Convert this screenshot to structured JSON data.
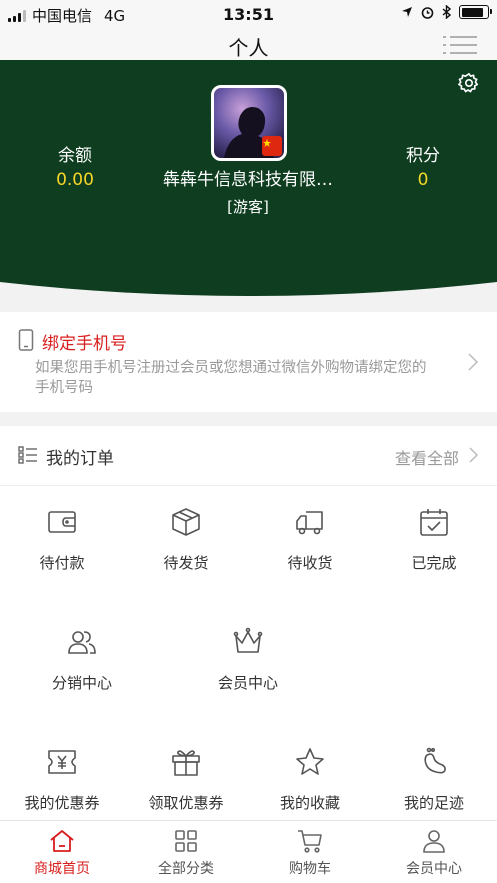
{
  "status_bar": {
    "carrier": "中国电信",
    "network": "4G",
    "time": "13:51"
  },
  "nav": {
    "title": "个人"
  },
  "profile": {
    "balance_label": "余额",
    "balance_value": "0.00",
    "points_label": "积分",
    "points_value": "0",
    "company_name": "犇犇牛信息科技有限…",
    "role": "[游客]"
  },
  "bind_phone": {
    "title": "绑定手机号",
    "description": "如果您用手机号注册过会员或您想通过微信外购物请绑定您的手机号码"
  },
  "orders": {
    "title": "我的订单",
    "view_all": "查看全部",
    "items": [
      {
        "label": "待付款",
        "icon": "wallet-icon"
      },
      {
        "label": "待发货",
        "icon": "package-icon"
      },
      {
        "label": "待收货",
        "icon": "truck-icon"
      },
      {
        "label": "已完成",
        "icon": "calendar-check-icon"
      },
      {
        "label": "分销中心",
        "icon": "users-icon"
      },
      {
        "label": "会员中心",
        "icon": "crown-icon"
      },
      {
        "label": "我的优惠券",
        "icon": "coupon-icon"
      },
      {
        "label": "领取优惠券",
        "icon": "gift-icon"
      },
      {
        "label": "我的收藏",
        "icon": "star-icon"
      },
      {
        "label": "我的足迹",
        "icon": "footprint-icon"
      }
    ]
  },
  "tabbar": {
    "items": [
      {
        "label": "商城首页",
        "icon": "home-icon",
        "active": true
      },
      {
        "label": "全部分类",
        "icon": "grid-icon",
        "active": false
      },
      {
        "label": "购物车",
        "icon": "cart-icon",
        "active": false
      },
      {
        "label": "会员中心",
        "icon": "user-icon",
        "active": false
      }
    ]
  },
  "colors": {
    "header_bg": "#0e3d20",
    "accent_red": "#d81e1e",
    "value_yellow": "#f7d629"
  }
}
